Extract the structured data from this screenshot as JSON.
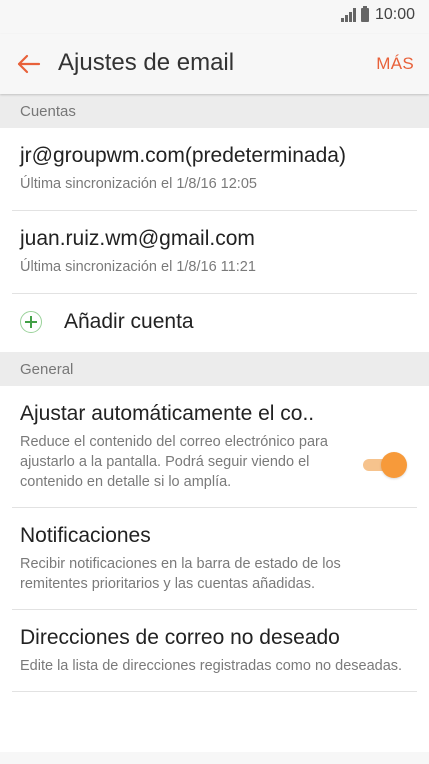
{
  "status_bar": {
    "time": "10:00"
  },
  "app_bar": {
    "back_icon": "arrow-left-icon",
    "title": "Ajustes de email",
    "more_label": "MÁS",
    "accent_color": "#e8613a"
  },
  "sections": {
    "accounts_header": "Cuentas",
    "general_header": "General"
  },
  "accounts": [
    {
      "email": "jr@groupwm.com(predeterminada)",
      "sync": "Última sincronización el 1/8/16  12:05"
    },
    {
      "email": "juan.ruiz.wm@gmail.com",
      "sync": "Última sincronización el 1/8/16  11:21"
    }
  ],
  "add_account": {
    "icon": "plus-circle-icon",
    "label": "Añadir cuenta"
  },
  "general": {
    "auto_fit": {
      "title": "Ajustar automáticamente el co..",
      "description": "Reduce el contenido del correo electrónico para ajustarlo a la pantalla. Podrá seguir viendo el contenido en detalle si lo amplía.",
      "toggle_on": true,
      "toggle_color": "#f79a3a"
    },
    "notifications": {
      "title": "Notificaciones",
      "description": "Recibir notificaciones en la barra de estado de los remitentes prioritarios y las cuentas añadidas."
    },
    "spam": {
      "title": "Direcciones de correo no deseado",
      "description": "Edite la lista de direcciones registradas como no deseadas."
    }
  }
}
